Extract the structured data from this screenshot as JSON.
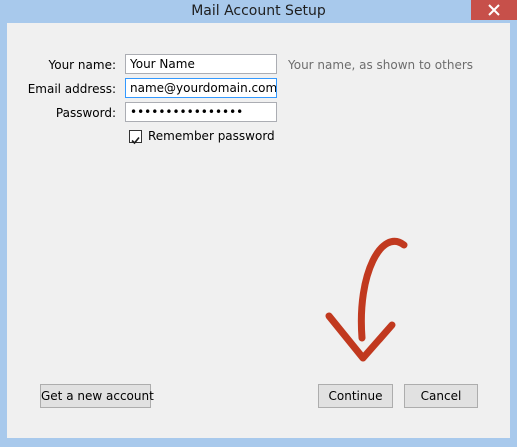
{
  "window": {
    "title": "Mail Account Setup",
    "close_icon": "close-icon"
  },
  "form": {
    "name_label": "Your name:",
    "name_value": "Your Name",
    "name_hint": "Your name, as shown to others",
    "email_label": "Email address:",
    "email_value": "name@yourdomain.com",
    "password_label": "Password:",
    "password_value": "••••••••••••••••",
    "remember_label": "Remember password",
    "remember_checked": true
  },
  "buttons": {
    "get_account": "Get a new account",
    "continue": "Continue",
    "cancel": "Cancel"
  },
  "annotation": {
    "arrow_color": "#c1391f"
  },
  "colors": {
    "titlebar_bg": "#a8c9ec",
    "client_bg": "#f0f0f0",
    "close_bg": "#c7504a"
  }
}
